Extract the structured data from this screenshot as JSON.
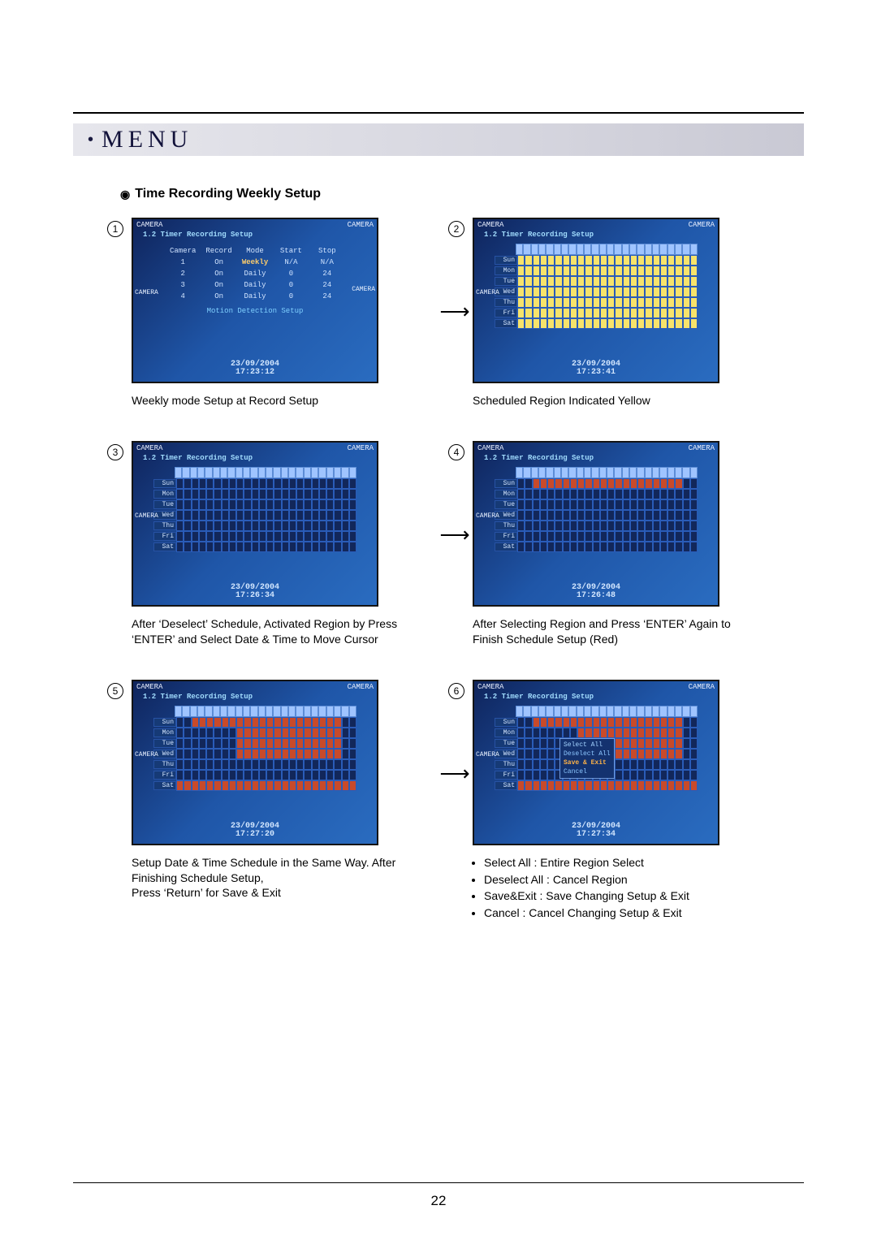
{
  "header": {
    "menu_label": "MENU"
  },
  "section": {
    "heading": "Time Recording Weekly Setup"
  },
  "dvr": {
    "cam_label": "CAMERA",
    "panel_title": "1.2 Timer Recording Setup",
    "motion_link": "Motion Detection Setup",
    "table": {
      "headers": [
        "Camera",
        "Record",
        "Mode",
        "Start",
        "Stop"
      ],
      "rows": [
        [
          "1",
          "On",
          "Weekly",
          "N/A",
          "N/A"
        ],
        [
          "2",
          "On",
          "Daily",
          "0",
          "24"
        ],
        [
          "3",
          "On",
          "Daily",
          "0",
          "24"
        ],
        [
          "4",
          "On",
          "Daily",
          "0",
          "24"
        ]
      ],
      "hl_mode_text": "Weekly"
    },
    "days": [
      "Sun",
      "Mon",
      "Tue",
      "Wed",
      "Thu",
      "Fri",
      "Sat"
    ],
    "popup": {
      "select_all": "Select All",
      "deselect_all": "Deselect All",
      "save_exit": "Save & Exit",
      "cancel": "Cancel"
    },
    "timestamps": {
      "p1": "23/09/2004\n17:23:12",
      "p2": "23/09/2004\n17:23:41",
      "p3": "23/09/2004\n17:26:34",
      "p4": "23/09/2004\n17:26:48",
      "p5": "23/09/2004\n17:27:20",
      "p6": "23/09/2004\n17:27:34"
    }
  },
  "captions": {
    "c1": "Weekly mode Setup at Record Setup",
    "c2": "Scheduled Region Indicated Yellow",
    "c3": "After ‘Deselect’ Schedule, Activated Region by Press ‘ENTER’ and Select Date & Time to Move Cursor",
    "c4": "After Selecting Region and Press ‘ENTER’ Again to Finish Schedule Setup (Red)",
    "c5": "Setup Date & Time Schedule in the Same Way. After Finishing Schedule Setup,\nPress ‘Return’ for Save & Exit",
    "c6_items": [
      "Select All : Entire Region Select",
      "Deselect All : Cancel Region",
      "Save&Exit : Save Changing Setup & Exit",
      "Cancel : Cancel Changing Setup & Exit"
    ]
  },
  "page_number": "22"
}
